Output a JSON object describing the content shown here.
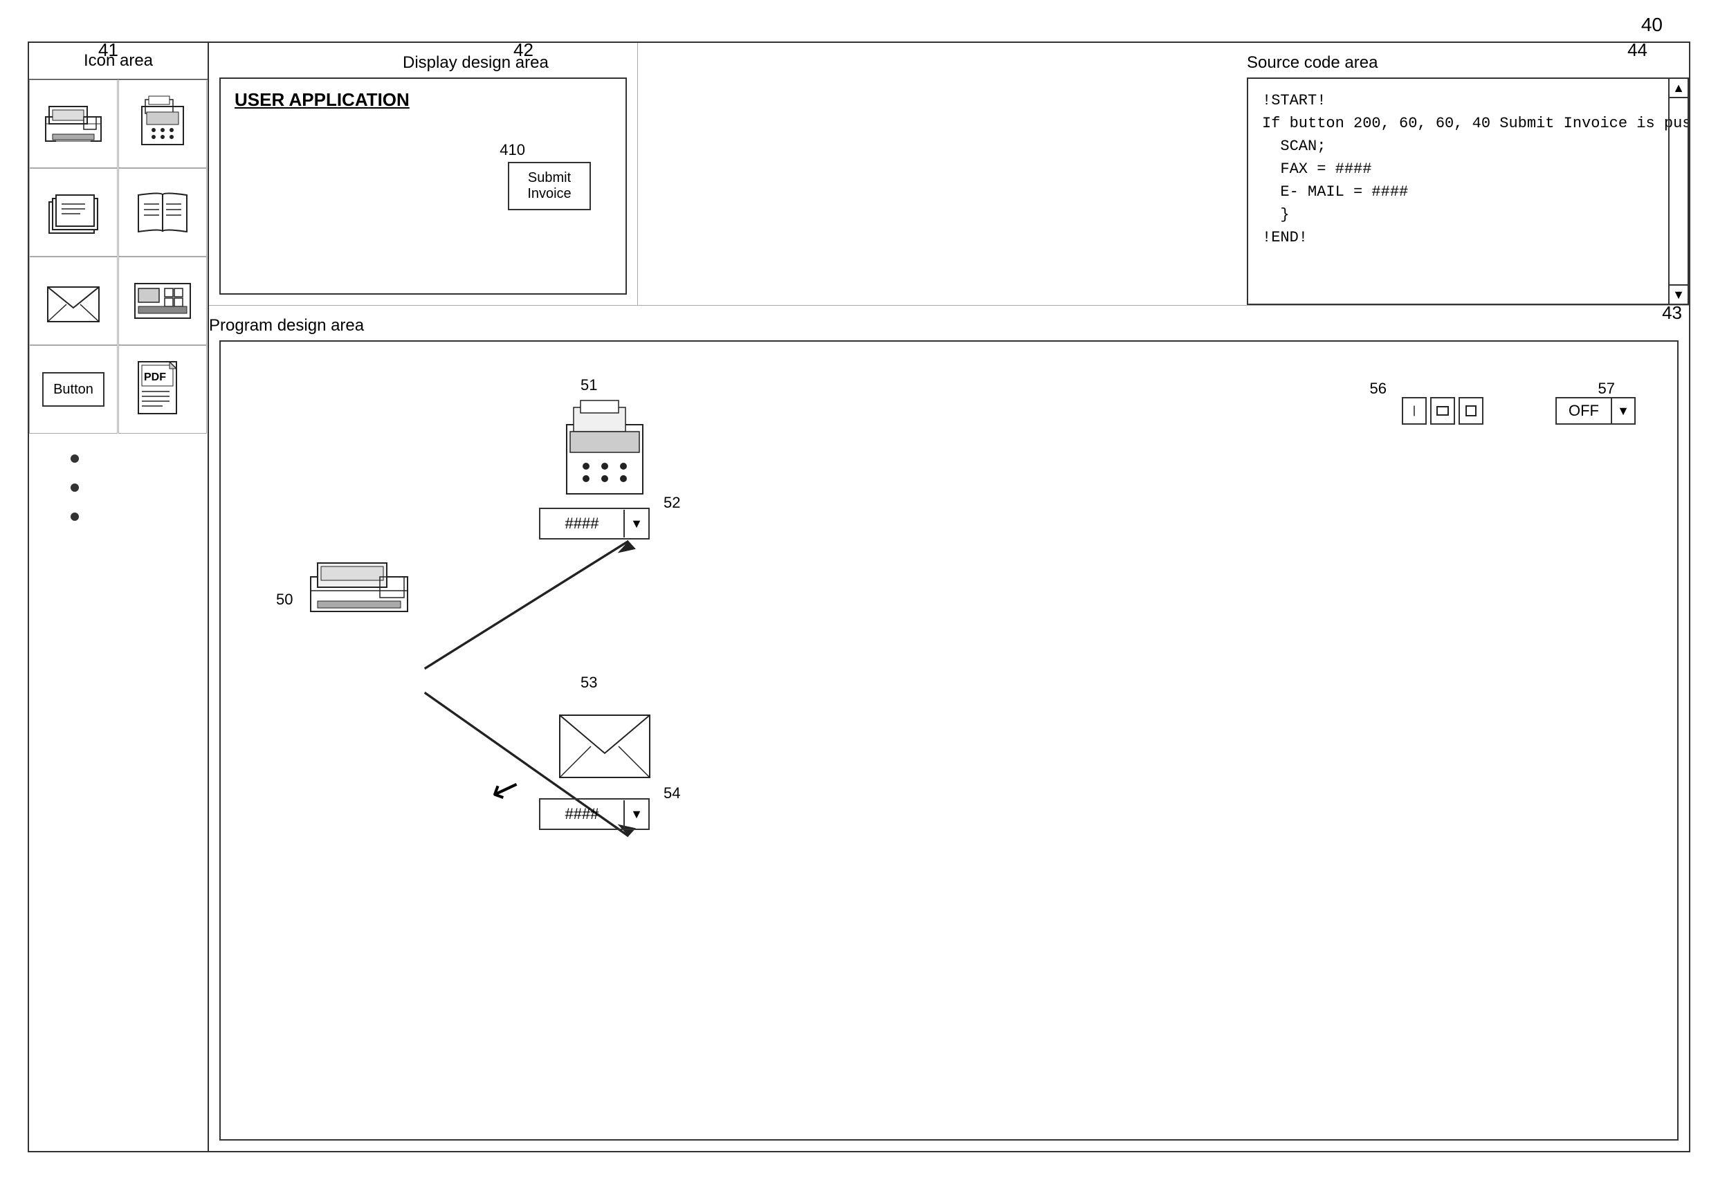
{
  "labels": {
    "label_40": "40",
    "label_41": "41",
    "label_42": "42",
    "label_43": "43",
    "label_44": "44",
    "label_50": "50",
    "label_51": "51",
    "label_52": "52",
    "label_53": "53",
    "label_54": "54",
    "label_56": "56",
    "label_57": "57",
    "label_410": "410"
  },
  "icon_area": {
    "title": "Icon area",
    "dots": [
      "•",
      "•",
      "•"
    ]
  },
  "display_design": {
    "area_label": "Display design area",
    "app_title": "USER APPLICATION",
    "button_label": "Submit\nInvoice"
  },
  "source_code": {
    "area_label": "Source code area",
    "code": "!START!\nIf button 200, 60, 60, 40 Submit Invoice is pushed then {\n  SCAN;\n  FAX = ####\n  E- MAIL = ####\n  }\n!END!"
  },
  "program_design": {
    "area_label": "Program design area"
  },
  "diagram": {
    "dropdown_52_text": "####",
    "dropdown_54_text": "####",
    "off_label": "OFF",
    "arrow_char": "▼",
    "arrow_indicator": "↗"
  },
  "button_label": "Button",
  "pdf_label": "PDF"
}
